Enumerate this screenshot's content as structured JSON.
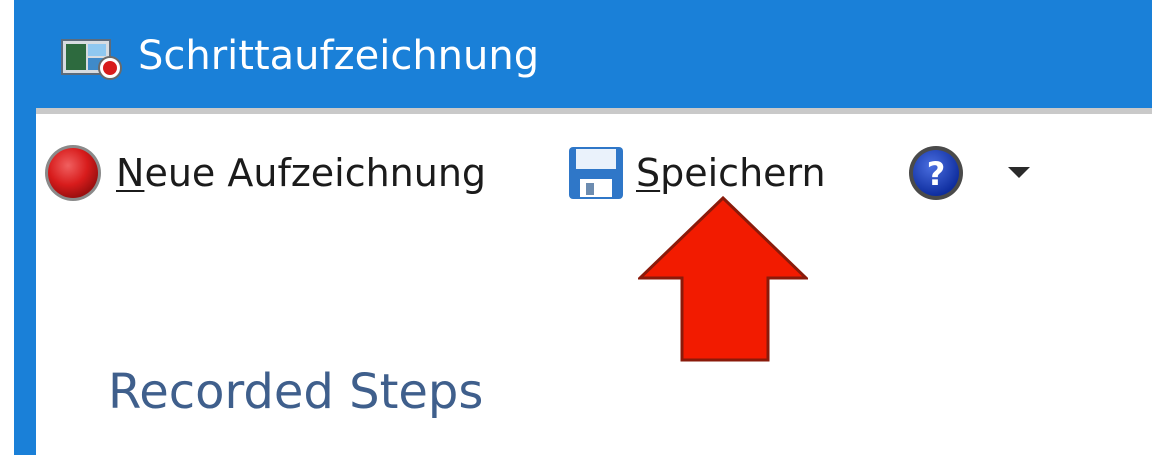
{
  "window": {
    "title": "Schrittaufzeichnung"
  },
  "toolbar": {
    "new_recording": {
      "mnemonic": "N",
      "rest": "eue Aufzeichnung",
      "icon": "record-icon"
    },
    "save": {
      "mnemonic": "S",
      "rest": "peichern",
      "icon": "floppy-disk-icon"
    },
    "help": {
      "icon": "help-icon"
    },
    "dropdown": {
      "icon": "dropdown-triangle-icon"
    }
  },
  "content": {
    "section_title": "Recorded Steps"
  },
  "annotation": {
    "icon": "red-arrow-up-icon",
    "color": "#f21b00"
  },
  "colors": {
    "titlebar": "#1a80d8",
    "section_title": "#3f5f8c",
    "record": "#d81c1c"
  }
}
